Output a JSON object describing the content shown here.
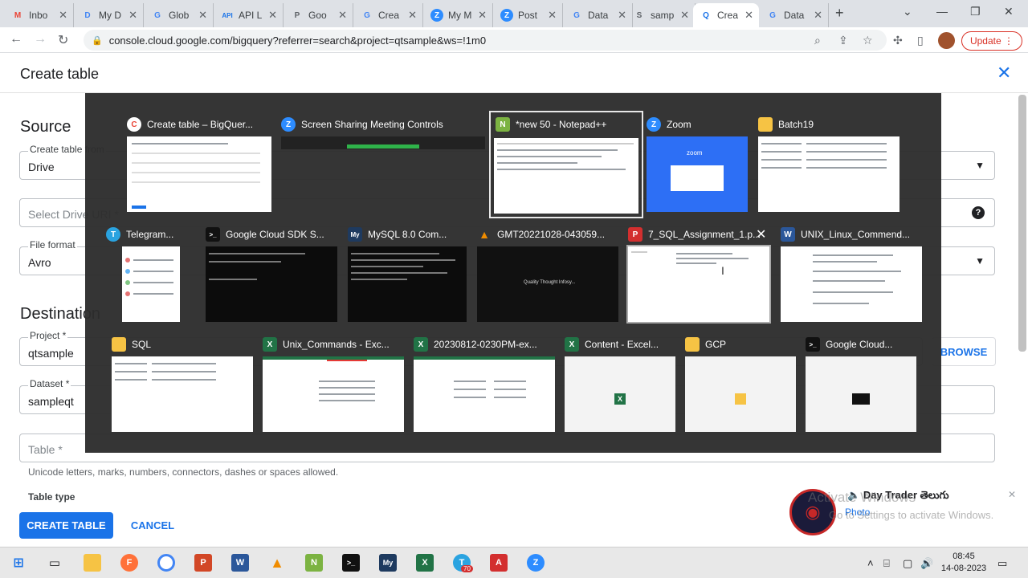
{
  "browser": {
    "tabs": [
      {
        "label": "Inbo",
        "icon": "gmail-icon",
        "color": "#ea4335",
        "glyph": "M"
      },
      {
        "label": "My D",
        "icon": "drive-icon",
        "color": "#4285f4",
        "glyph": "D"
      },
      {
        "label": "Glob",
        "icon": "gcloud-icon",
        "color": "#4285f4",
        "glyph": "G"
      },
      {
        "label": "API L",
        "icon": "api-icon",
        "color": "#1a73e8",
        "glyph": "API"
      },
      {
        "label": "Goo",
        "icon": "person-icon",
        "color": "#5f6368",
        "glyph": "P"
      },
      {
        "label": "Crea",
        "icon": "gcloud-icon",
        "color": "#4285f4",
        "glyph": "G"
      },
      {
        "label": "My M",
        "icon": "zoom-icon",
        "color": "#2d8cff",
        "glyph": "Z"
      },
      {
        "label": "Post",
        "icon": "zoom-icon",
        "color": "#2d8cff",
        "glyph": "Z"
      },
      {
        "label": "Data",
        "icon": "gcloud-icon",
        "color": "#4285f4",
        "glyph": "G"
      },
      {
        "label": "samp",
        "icon": "sheet-icon",
        "color": "#5f6368",
        "glyph": "S"
      },
      {
        "label": "Crea",
        "icon": "search-icon",
        "color": "#1a73e8",
        "glyph": "Q"
      },
      {
        "label": "Data",
        "icon": "gcloud-icon",
        "color": "#4285f4",
        "glyph": "G"
      }
    ],
    "url": "console.cloud.google.com/bigquery?referrer=search&project=qtsample&ws=!1m0",
    "update_label": "Update"
  },
  "page": {
    "title": "Create table",
    "source_title": "Source",
    "destination_title": "Destination",
    "create_from_label": "Create table from",
    "create_from_value": "Drive",
    "select_drive_placeholder": "Select Drive URI *",
    "file_format_label": "File format",
    "file_format_value": "Avro",
    "project_label": "Project *",
    "project_value": "qtsample",
    "browse_label": "BROWSE",
    "dataset_label": "Dataset *",
    "dataset_value": "sampleqt",
    "table_placeholder": "Table *",
    "table_hint": "Unicode letters, marks, numbers, connectors, dashes or spaces allowed.",
    "table_type_label": "Table type",
    "create_button": "CREATE TABLE",
    "cancel_button": "CANCEL"
  },
  "switcher": {
    "windows": [
      {
        "title": "Create table – BigQuer...",
        "icon": "chrome-icon",
        "color": "#4285f4",
        "glyph": "C"
      },
      {
        "title": "Screen Sharing Meeting Controls",
        "icon": "zoom-icon",
        "color": "#2d8cff",
        "glyph": "Z"
      },
      {
        "title": "*new 50 - Notepad++",
        "icon": "notepadpp-icon",
        "color": "#7cb342",
        "glyph": "N"
      },
      {
        "title": "Zoom",
        "icon": "zoom-icon",
        "color": "#2d8cff",
        "glyph": "Z"
      },
      {
        "title": "Batch19",
        "icon": "folder-icon",
        "color": "#f6c344",
        "glyph": ""
      },
      {
        "title": "Telegram...",
        "icon": "telegram-icon",
        "color": "#2aa3e0",
        "glyph": "T"
      },
      {
        "title": "Google Cloud SDK S...",
        "icon": "terminal-icon",
        "color": "#111111",
        "glyph": ">_"
      },
      {
        "title": "MySQL 8.0 Com...",
        "icon": "mysql-icon",
        "color": "#1e3a5f",
        "glyph": "My"
      },
      {
        "title": "GMT20221028-043059...",
        "icon": "vlc-icon",
        "color": "#f08c00",
        "glyph": "▲"
      },
      {
        "title": "7_SQL_Assignment_1.p...",
        "icon": "pdf-icon",
        "color": "#d32f2f",
        "glyph": "P"
      },
      {
        "title": "UNIX_Linux_Commend...",
        "icon": "word-icon",
        "color": "#2b579a",
        "glyph": "W"
      },
      {
        "title": "SQL",
        "icon": "folder-icon",
        "color": "#f6c344",
        "glyph": ""
      },
      {
        "title": "Unix_Commands - Exc...",
        "icon": "excel-icon",
        "color": "#217346",
        "glyph": "X"
      },
      {
        "title": "20230812-0230PM-ex...",
        "icon": "excel-icon",
        "color": "#217346",
        "glyph": "X"
      },
      {
        "title": "Content - Excel...",
        "icon": "excel-icon",
        "color": "#217346",
        "glyph": "X"
      },
      {
        "title": "GCP",
        "icon": "folder-icon",
        "color": "#f6c344",
        "glyph": ""
      },
      {
        "title": "Google Cloud...",
        "icon": "terminal-icon",
        "color": "#111111",
        "glyph": ">_"
      }
    ],
    "zoom_thumb_text": "zoom",
    "video_thumb_text": "Quality Thought Infosy..."
  },
  "notification": {
    "title": "Day Trader తెలుగు",
    "subtitle": "Photo",
    "watermark_line1": "Activate Windows",
    "watermark_line2": "Go to Settings to activate Windows."
  },
  "taskbar": {
    "time": "08:45",
    "date": "14-08-2023",
    "telegram_badge": "70"
  }
}
